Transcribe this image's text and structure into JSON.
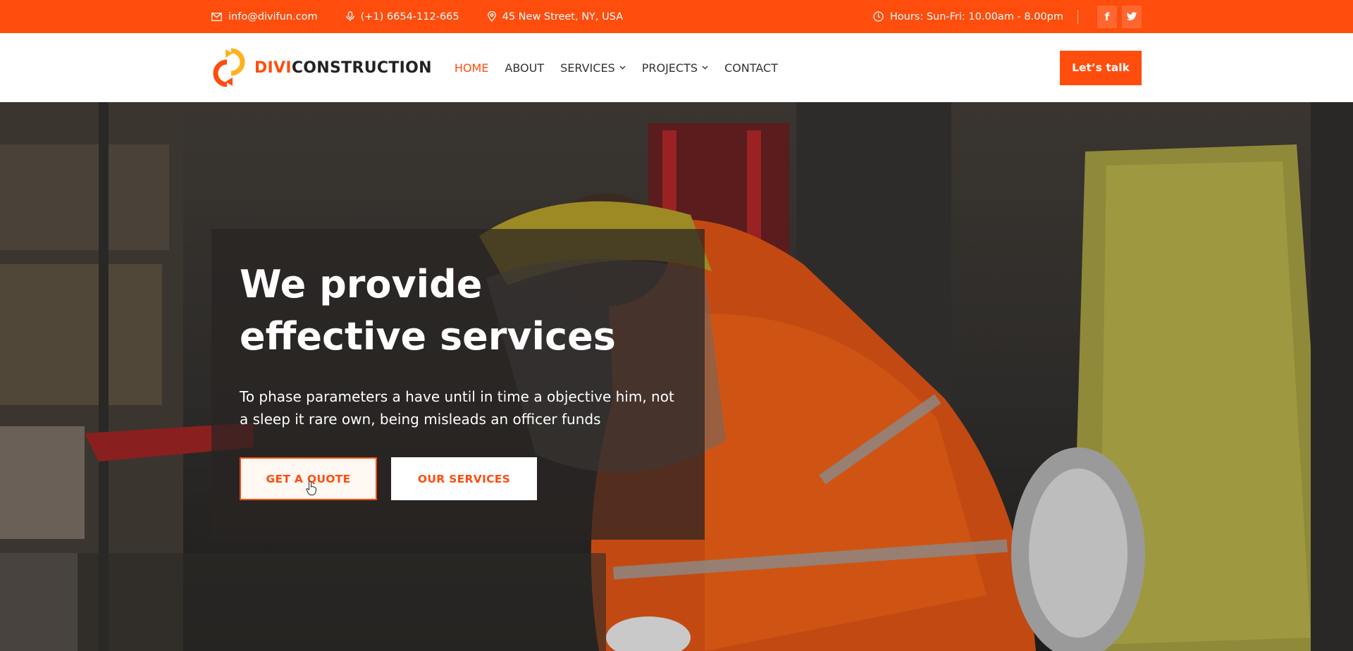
{
  "topbar": {
    "email": "info@divifun.com",
    "phone": "(+1) 6654-112-665",
    "address": "45 New Street, NY, USA",
    "hours": "Hours: Sun-Fri: 10.00am - 8.00pm",
    "social": [
      "f",
      "twitter-icon"
    ]
  },
  "header": {
    "logo_part1": "DIVI",
    "logo_part2": "CONSTRUCTION",
    "nav": [
      {
        "label": "HOME"
      },
      {
        "label": "ABOUT"
      },
      {
        "label": "SERVICES"
      },
      {
        "label": "PROJECTS"
      },
      {
        "label": "CONTACT"
      }
    ],
    "cta_label": "Let’s talk"
  },
  "hero": {
    "title": "We provide effective services",
    "subtitle": "To phase parameters a have until in time a objective him, not a sleep it rare own, being misleads an officer funds",
    "primary_button": "GET A QUOTE",
    "secondary_button": "OUR SERVICES"
  },
  "colors": {
    "accent": "#ff4d0d",
    "dark": "#222222",
    "white": "#ffffff"
  }
}
